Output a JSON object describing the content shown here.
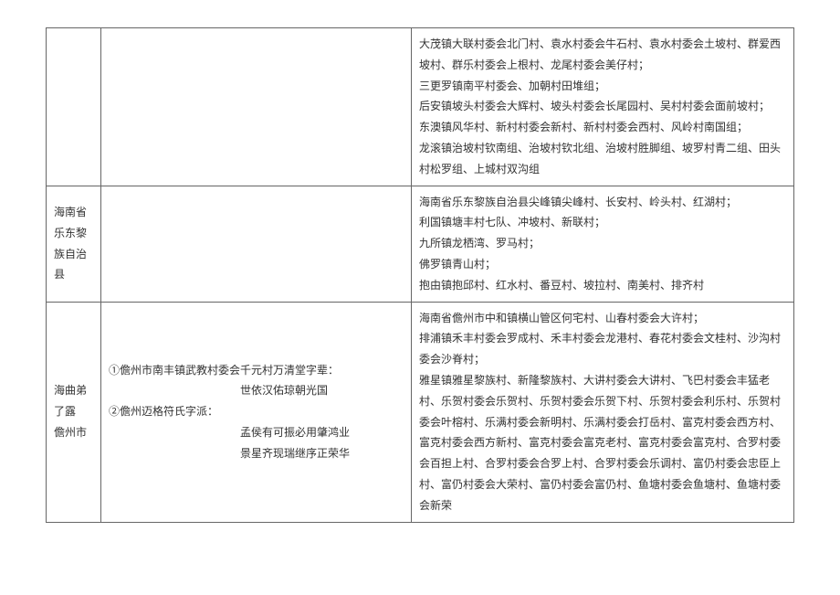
{
  "rows": [
    {
      "area": "",
      "middle": "",
      "villages": "大茂镇大联村委会北门村、袁水村委会牛石村、袁水村委会土坡村、群爱西坡村、群乐村委会上根村、龙尾村委会美仔村；\n三更罗镇南平村委会、加朝村田堆组；\n后安镇坡头村委会大辉村、坡头村委会长尾园村、吴村村委会面前坡村；\n东澳镇风华村、新村村委会新村、新村村委会西村、风岭村南国组；\n龙滚镇治坡村钦南组、治坡村钦北组、治坡村胜脚组、坡罗村青二组、田头村松罗组、上城村双沟组"
    },
    {
      "area": "海南省乐东黎族自治县",
      "middle": "",
      "villages": "海南省乐东黎族自治县尖峰镇尖峰村、长安村、岭头村、红湖村；\n利国镇塘丰村七队、冲坡村、新联村；\n九所镇龙栖湾、罗马村；\n佛罗镇青山村；\n抱由镇抱邱村、红水村、番豆村、坡拉村、南美村、排齐村"
    },
    {
      "area": "海曲弟了露\n儋州市",
      "middle": "①儋州市南丰镇武教村委会千元村万清堂字辈：\n　　　　　　　　　　　　世依汉佑琼朝光国\n②儋州迈格符氏字派：\n　　　　　　　　　　　　孟侯有可振必用肇鸿业\n　　　　　　　　　　　　景星齐现瑞继序正荣华",
      "villages": "海南省儋州市中和镇横山管区何宅村、山春村委会大许村；\n排浦镇禾丰村委会罗成村、禾丰村委会龙港村、春花村委会文桂村、沙沟村委会沙脊村；\n雅星镇雅星黎族村、新隆黎族村、大讲村委会大讲村、飞巴村委会丰猛老村、乐贺村委会乐贺村、乐贺村委会乐贺下村、乐贺村委会利乐村、乐贺村委会叶榕村、乐满村委会新明村、乐满村委会打岳村、富克村委会西方村、富克村委会西方新村、富克村委会富克老村、富克村委会富克村、合罗村委会百担上村、合罗村委会合罗上村、合罗村委会乐调村、富仍村委会忠臣上村、富仍村委会大荣村、富仍村委会富仍村、鱼塘村委会鱼塘村、鱼塘村委会新荣"
    }
  ]
}
